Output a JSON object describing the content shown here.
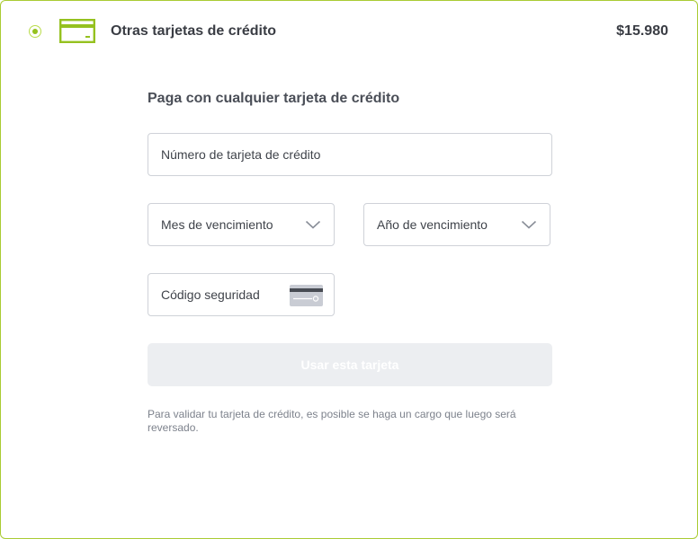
{
  "payment_option": {
    "title": "Otras tarjetas de crédito",
    "price": "$15.980",
    "selected": true,
    "icon": "credit-card-icon",
    "accent_color": "#95c11f"
  },
  "form": {
    "title": "Paga con cualquier tarjeta de crédito",
    "card_number_placeholder": "Número de tarjeta de crédito",
    "expiry_month_placeholder": "Mes de vencimiento",
    "expiry_year_placeholder": "Año de vencimiento",
    "security_code_placeholder": "Código seguridad",
    "submit_label": "Usar esta tarjeta",
    "submit_enabled": false,
    "validation_note": "Para validar tu tarjeta de crédito, es posible se haga un cargo que luego será reversado."
  }
}
